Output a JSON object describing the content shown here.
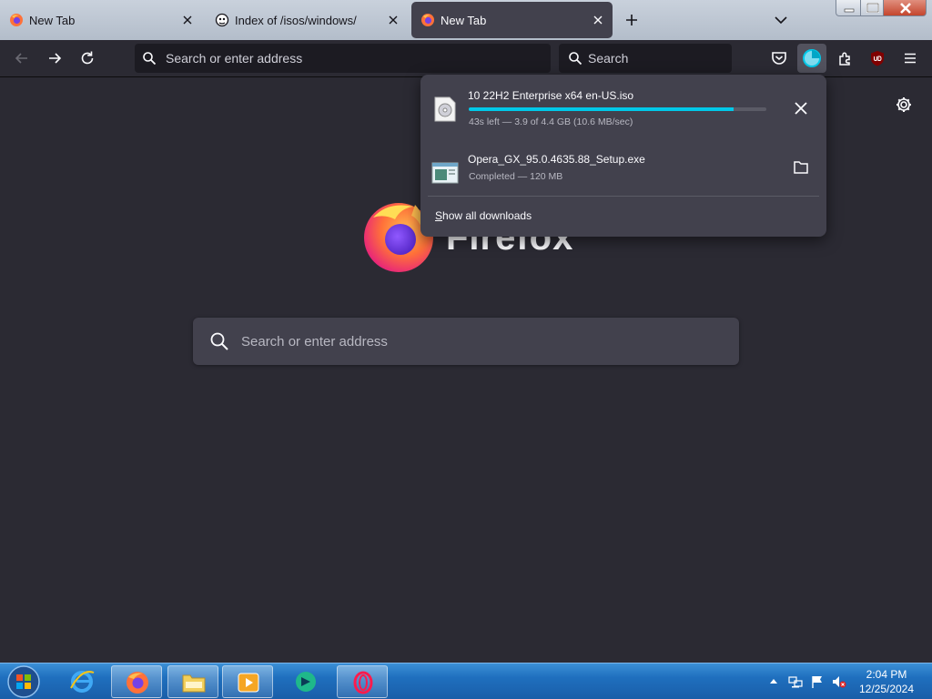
{
  "tabs": [
    {
      "label": "New Tab",
      "icon": "firefox-icon",
      "active": false
    },
    {
      "label": "Index of /isos/windows/",
      "icon": "site-icon",
      "active": false
    },
    {
      "label": "New Tab",
      "icon": "firefox-icon",
      "active": true
    }
  ],
  "toolbar": {
    "url_placeholder": "Search or enter address",
    "search_placeholder": "Search"
  },
  "page": {
    "brand": "Firefox",
    "search_placeholder": "Search or enter address"
  },
  "downloads": {
    "items": [
      {
        "name": "10 22H2 Enterprise x64 en-US.iso",
        "status": "43s left — 3.9 of 4.4 GB (10.6 MB/sec)",
        "progress_percent": 89,
        "action": "cancel-icon"
      },
      {
        "name": "Opera_GX_95.0.4635.88_Setup.exe",
        "status": "Completed — 120 MB",
        "action": "folder-icon"
      }
    ],
    "show_all_label": "Show all downloads"
  },
  "taskbar": {
    "clock_time": "2:04 PM",
    "clock_date": "12/25/2024"
  },
  "colors": {
    "accent": "#00c8e8",
    "page_bg": "#2b2a33",
    "panel_bg": "#42414d"
  }
}
